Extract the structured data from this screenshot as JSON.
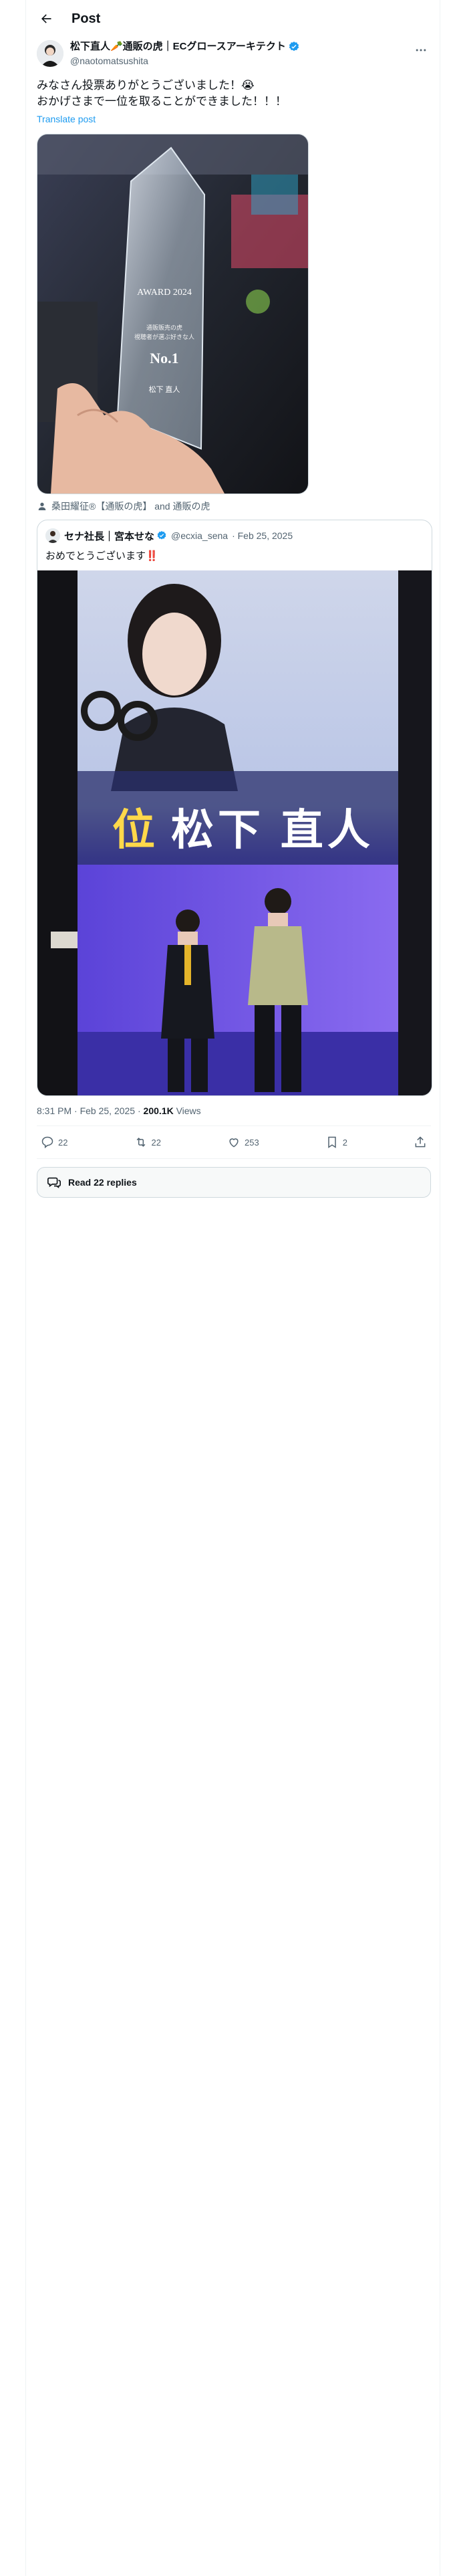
{
  "header": {
    "title": "Post"
  },
  "post": {
    "author_name": "松下直人🥕通販の虎｜ECグロースアーキテクト",
    "handle": "@naotomatsushita",
    "text": "みなさん投票ありがとうございました！😭\nおかげさまで一位を取ることができました！！！",
    "translate_label": "Translate post",
    "tagged_text": "桑田耀征®【通販の虎】 and 通販の虎",
    "photo_trophy": {
      "award_text": "AWARD 2024",
      "line1": "通販販売の虎",
      "line2": "視聴者が選ぶ好きな人",
      "rank": "No.1",
      "name": "松下 直人"
    }
  },
  "quote": {
    "author_name": "セナ社長｜宮本せな",
    "handle": "@ecxia_sena",
    "date": "· Feb 25, 2025",
    "text": "おめでとうございます‼️",
    "photo_banner_rank": "位",
    "photo_banner_name": "松下 直人"
  },
  "meta": {
    "timestamp": "8:31 PM · Feb 25, 2025 · ",
    "views_count": "200.1K",
    "views_label": " Views"
  },
  "actions": {
    "replies": "22",
    "reposts": "22",
    "likes": "253",
    "bookmarks": "2"
  },
  "read_replies_label": "Read 22 replies",
  "icons": [
    "back-arrow-icon",
    "verified-badge-icon",
    "more-icon",
    "person-icon",
    "reply-icon",
    "repost-icon",
    "like-icon",
    "bookmark-icon",
    "share-icon",
    "chat-bubbles-icon"
  ],
  "colors": {
    "accent": "#1d9bf0",
    "secondary_text": "#536471",
    "border": "#cfd9de"
  }
}
